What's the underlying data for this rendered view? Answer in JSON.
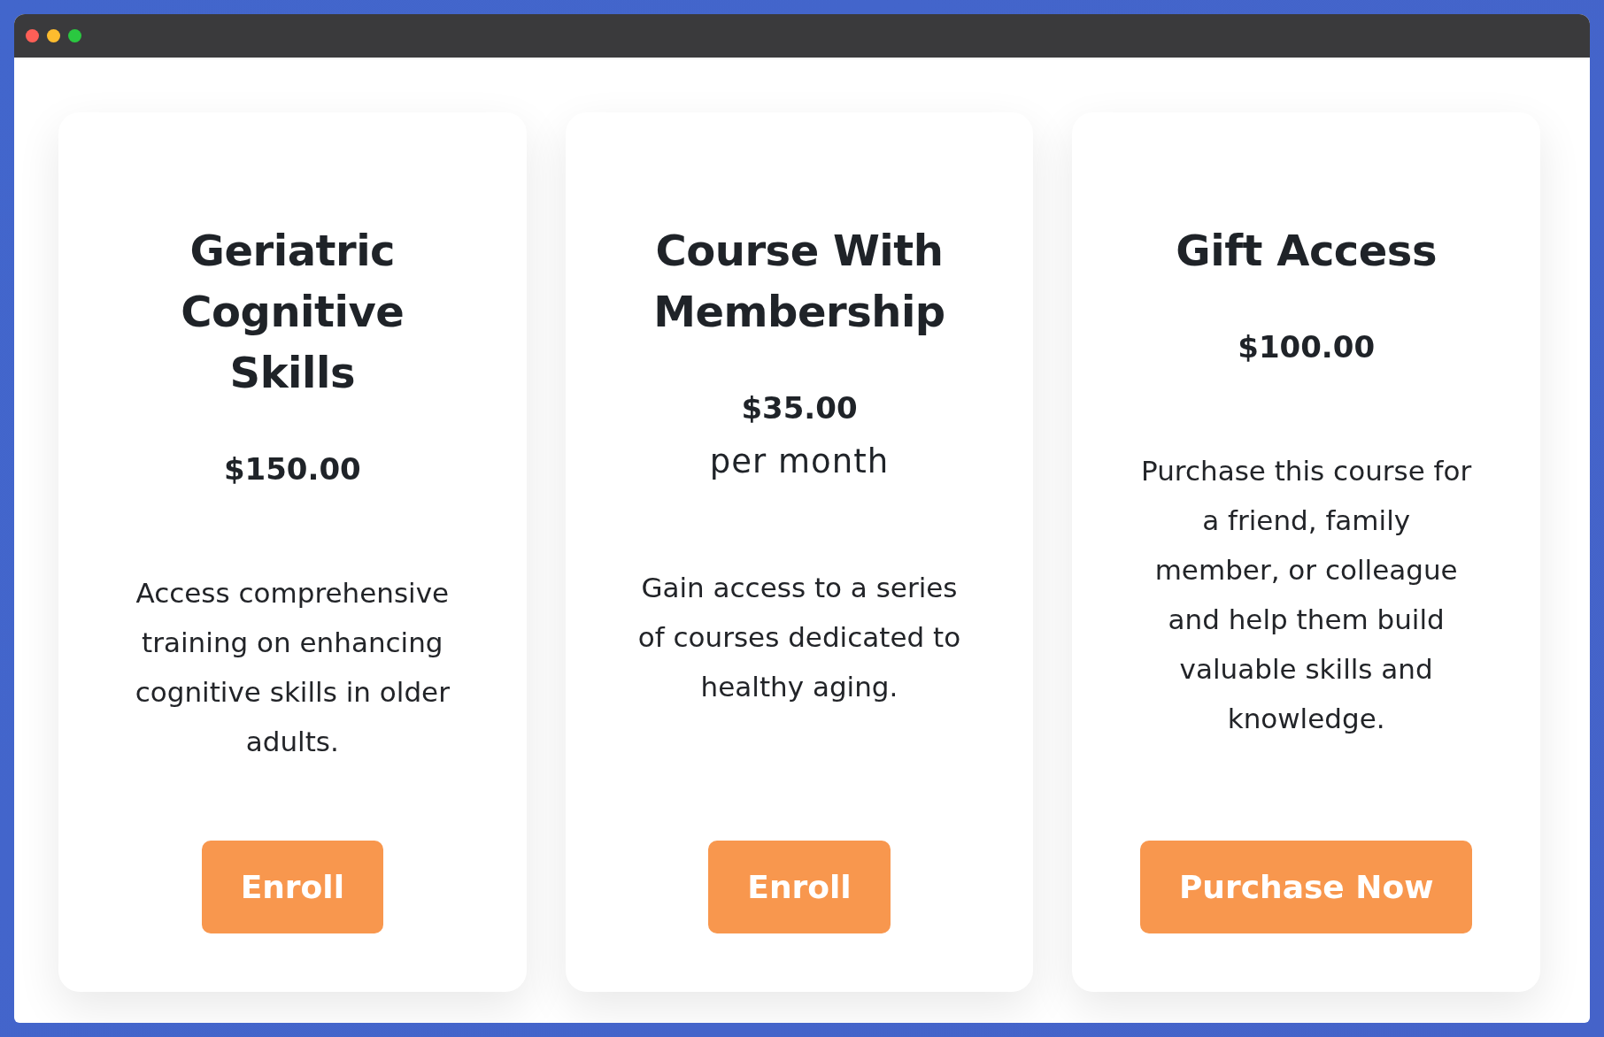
{
  "window": {
    "controls": [
      {
        "color": "#fe5f57"
      },
      {
        "color": "#febc2e"
      },
      {
        "color": "#2ac840"
      }
    ]
  },
  "plans": [
    {
      "title": "Geriatric Cognitive Skills",
      "price": "$150.00",
      "description": "Access comprehensive training on enhancing cognitive skills in older adults.",
      "button": "Enroll"
    },
    {
      "title": "Course With Membership",
      "price": "$35.00",
      "period": "per month",
      "description": "Gain access to a series of courses dedicated to healthy aging.",
      "button": "Enroll"
    },
    {
      "title": "Gift Access",
      "price": "$100.00",
      "description": "Purchase this course for a friend, family member, or colleague and help them build valuable skills and knowledge.",
      "button": "Purchase Now"
    }
  ]
}
